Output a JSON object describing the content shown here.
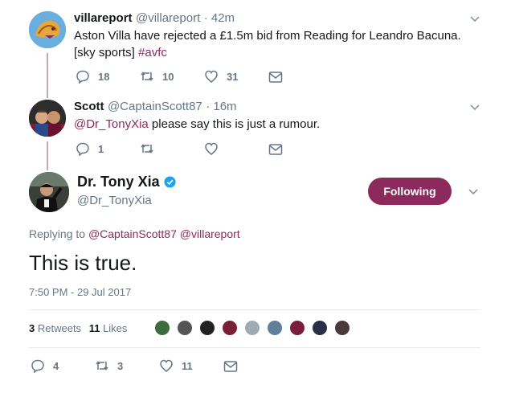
{
  "tweet1": {
    "name": "villareport",
    "handle": "@villareport",
    "time": "· 42m",
    "text": "Aston Villa have rejected a £1.5m bid from Reading for Leandro Bacuna. [sky sports]",
    "hashtag": "#avfc",
    "replies": "18",
    "retweets": "10",
    "likes": "31"
  },
  "tweet2": {
    "name": "Scott",
    "handle": "@CaptainScott87",
    "time": "· 16m",
    "mention": "@Dr_TonyXia",
    "text": " please say this is just a rumour.",
    "replies": "1"
  },
  "main": {
    "name": "Dr. Tony Xia",
    "handle": "@Dr_TonyXia",
    "follow_label": "Following",
    "replying_prefix": "Replying to",
    "replying_to1": "@CaptainScott87",
    "replying_to2": "@villareport",
    "text": "This is true.",
    "timestamp": "7:50 PM - 29 Jul 2017",
    "retweets_count": "3",
    "retweets_label": "Retweets",
    "likes_count": "11",
    "likes_label": "Likes",
    "replies": "4",
    "retweets": "3",
    "likes": "11"
  },
  "colors": {
    "accent": "#8c2a5b",
    "verified": "#1da1f2",
    "muted": "#657786",
    "thread": "#c8a5b8"
  }
}
